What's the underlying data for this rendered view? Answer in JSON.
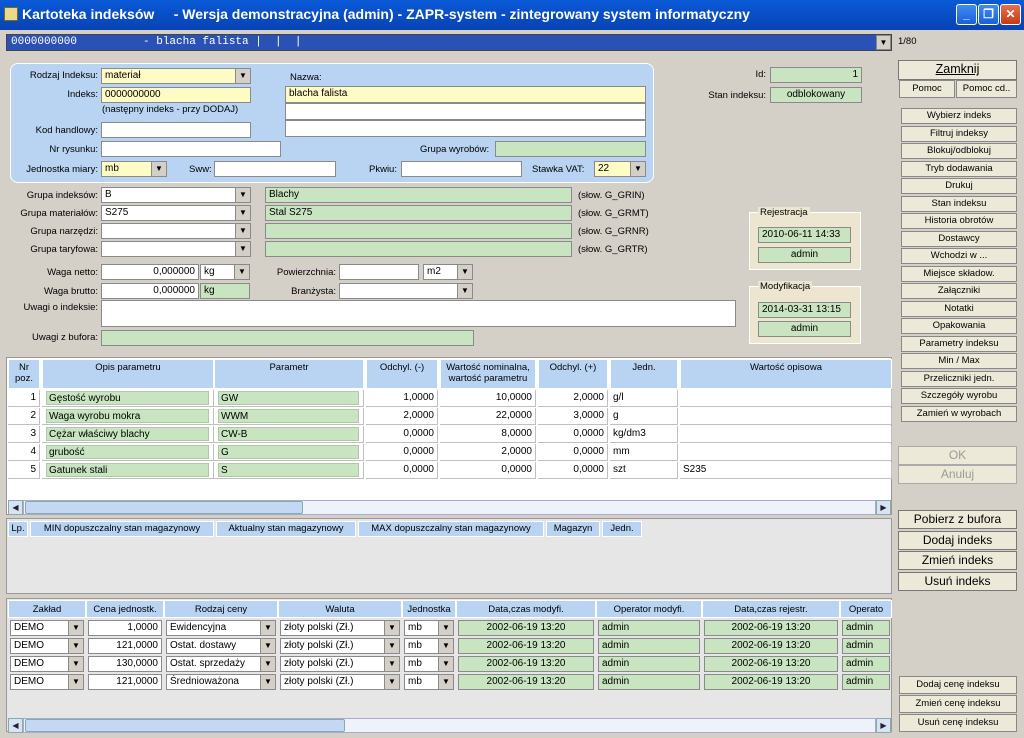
{
  "window": {
    "title": "Kartoteka indeksów     - Wersja demonstracyjna (admin) - ZAPR-system - zintegrowany system informatyczny",
    "min": "_",
    "max": "❐",
    "close": "✕"
  },
  "top": {
    "combo_value": "0000000000          - blacha falista |  |  |",
    "counter": "1/80"
  },
  "form": {
    "rodzaj_label": "Rodzaj Indeksu:",
    "rodzaj_value": "materiał",
    "indeks_label": "Indeks:",
    "indeks_value": "0000000000",
    "indeks_hint": "(następny indeks - przy DODAJ)",
    "nazwa_label": "Nazwa:",
    "nazwa_value": "blacha falista",
    "kod_label": "Kod handlowy:",
    "nr_rys_label": "Nr rysunku:",
    "grupa_wyr_label": "Grupa wyrobów:",
    "jm_label": "Jednostka miary:",
    "jm_value": "mb",
    "sww_label": "Sww:",
    "pkwiu_label": "Pkwiu:",
    "vat_label": "Stawka VAT:",
    "vat_value": "22",
    "id_label": "Id:",
    "id_value": "1",
    "stan_label": "Stan indeksu:",
    "stan_value": "odblokowany"
  },
  "groups": [
    {
      "label": "Grupa indeksów:",
      "code": "B",
      "name": "Blachy",
      "slow": "(słow. G_GRIN)"
    },
    {
      "label": "Grupa materiałów:",
      "code": "S275",
      "name": "Stal S275",
      "slow": "(słow. G_GRMT)"
    },
    {
      "label": "Grupa narzędzi:",
      "code": "",
      "name": "",
      "slow": "(słow. G_GRNR)"
    },
    {
      "label": "Grupa taryfowa:",
      "code": "",
      "name": "",
      "slow": "(słow. G_GRTR)"
    }
  ],
  "weights": {
    "netto_label": "Waga netto:",
    "netto_value": "0,000000",
    "netto_unit": "kg",
    "brutto_label": "Waga brutto:",
    "brutto_value": "0,000000",
    "brutto_unit": "kg",
    "pow_label": "Powierzchnia:",
    "pow_unit": "m2",
    "branz_label": "Branżysta:",
    "uwagi_label": "Uwagi o indeksie:",
    "uwagi_bufor_label": "Uwagi z bufora:"
  },
  "rejestracja": {
    "title": "Rejestracja",
    "date": "2010-06-11  14:33",
    "user": "admin"
  },
  "modyfikacja": {
    "title": "Modyfikacja",
    "date": "2014-03-31  13:15",
    "user": "admin"
  },
  "params": {
    "headers": [
      "Nr\npoz.",
      "Opis parametru",
      "Parametr",
      "Odchyl. (-)",
      "Wartość nominalna,\nwartość parametru",
      "Odchyl. (+)",
      "Jedn.",
      "Wartość opisowa"
    ],
    "rows": [
      {
        "nr": "1",
        "opis": "Gęstość wyrobu",
        "param": "GW",
        "minus": "1,0000",
        "nom": "10,0000",
        "plus": "2,0000",
        "jedn": "g/l",
        "opisowa": ""
      },
      {
        "nr": "2",
        "opis": "Waga wyrobu  mokra",
        "param": "WWM",
        "minus": "2,0000",
        "nom": "22,0000",
        "plus": "3,0000",
        "jedn": "g",
        "opisowa": ""
      },
      {
        "nr": "3",
        "opis": "Cężar właściwy blachy",
        "param": "CW-B",
        "minus": "0,0000",
        "nom": "8,0000",
        "plus": "0,0000",
        "jedn": "kg/dm3",
        "opisowa": ""
      },
      {
        "nr": "4",
        "opis": "grubość",
        "param": "G",
        "minus": "0,0000",
        "nom": "2,0000",
        "plus": "0,0000",
        "jedn": "mm",
        "opisowa": ""
      },
      {
        "nr": "5",
        "opis": "Gatunek stali",
        "param": "S",
        "minus": "0,0000",
        "nom": "0,0000",
        "plus": "0,0000",
        "jedn": "szt",
        "opisowa": "S235"
      }
    ]
  },
  "stock_tabs": [
    "Lp.",
    "MIN dopuszczalny stan magazynowy",
    "Aktualny stan magazynowy",
    "MAX dopuszczalny stan magazynowy",
    "Magazyn",
    "Jedn."
  ],
  "prices": {
    "headers": [
      "Zakład",
      "Cena jednostk.",
      "Rodzaj ceny",
      "Waluta",
      "Jednostka",
      "Data,czas modyfi.",
      "Operator modyfi.",
      "Data,czas rejestr.",
      "Operato"
    ],
    "rows": [
      {
        "zaklad": "DEMO",
        "cena": "1,0000",
        "rodzaj": "Ewidencyjna",
        "waluta": "złoty polski (Zł.)",
        "jedn": "mb",
        "dmod": "2002-06-19  13:20",
        "omod": "admin",
        "drej": "2002-06-19  13:20",
        "orej": "admin"
      },
      {
        "zaklad": "DEMO",
        "cena": "121,0000",
        "rodzaj": "Ostat.  dostawy",
        "waluta": "złoty polski (Zł.)",
        "jedn": "mb",
        "dmod": "2002-06-19  13:20",
        "omod": "admin",
        "drej": "2002-06-19  13:20",
        "orej": "admin"
      },
      {
        "zaklad": "DEMO",
        "cena": "130,0000",
        "rodzaj": "Ostat. sprzedaży",
        "waluta": "złoty polski (Zł.)",
        "jedn": "mb",
        "dmod": "2002-06-19  13:20",
        "omod": "admin",
        "drej": "2002-06-19  13:20",
        "orej": "admin"
      },
      {
        "zaklad": "DEMO",
        "cena": "121,0000",
        "rodzaj": "Średnioważona",
        "waluta": "złoty polski (Zł.)",
        "jedn": "mb",
        "dmod": "2002-06-19  13:20",
        "omod": "admin",
        "drej": "2002-06-19  13:20",
        "orej": "admin"
      }
    ]
  },
  "sidebar": {
    "zamknij": "Zamknij",
    "pomoc": "Pomoc",
    "pomoc_cd": "Pomoc cd..",
    "buttons": [
      "Wybierz indeks",
      "Filtruj indeksy",
      "Blokuj/odblokuj",
      "Tryb dodawania",
      "Drukuj",
      "Stan indeksu",
      "Historia obrotów",
      "Dostawcy",
      "Wchodzi w ...",
      "Miejsce składow.",
      "Załączniki",
      "Notatki",
      "Opakowania",
      "Parametry indeksu",
      "Min / Max",
      "Przeliczniki jedn.",
      "Szczegóły wyrobu",
      "Zamień w wyrobach"
    ],
    "ok": "OK",
    "anuluj": "Anuluj",
    "big": [
      "Pobierz z bufora",
      "Dodaj indeks",
      "Zmień indeks",
      "Usuń indeks"
    ],
    "price_btns": [
      "Dodaj cenę indeksu",
      "Zmień cenę indeksu",
      "Usuń cenę indeksu"
    ]
  }
}
